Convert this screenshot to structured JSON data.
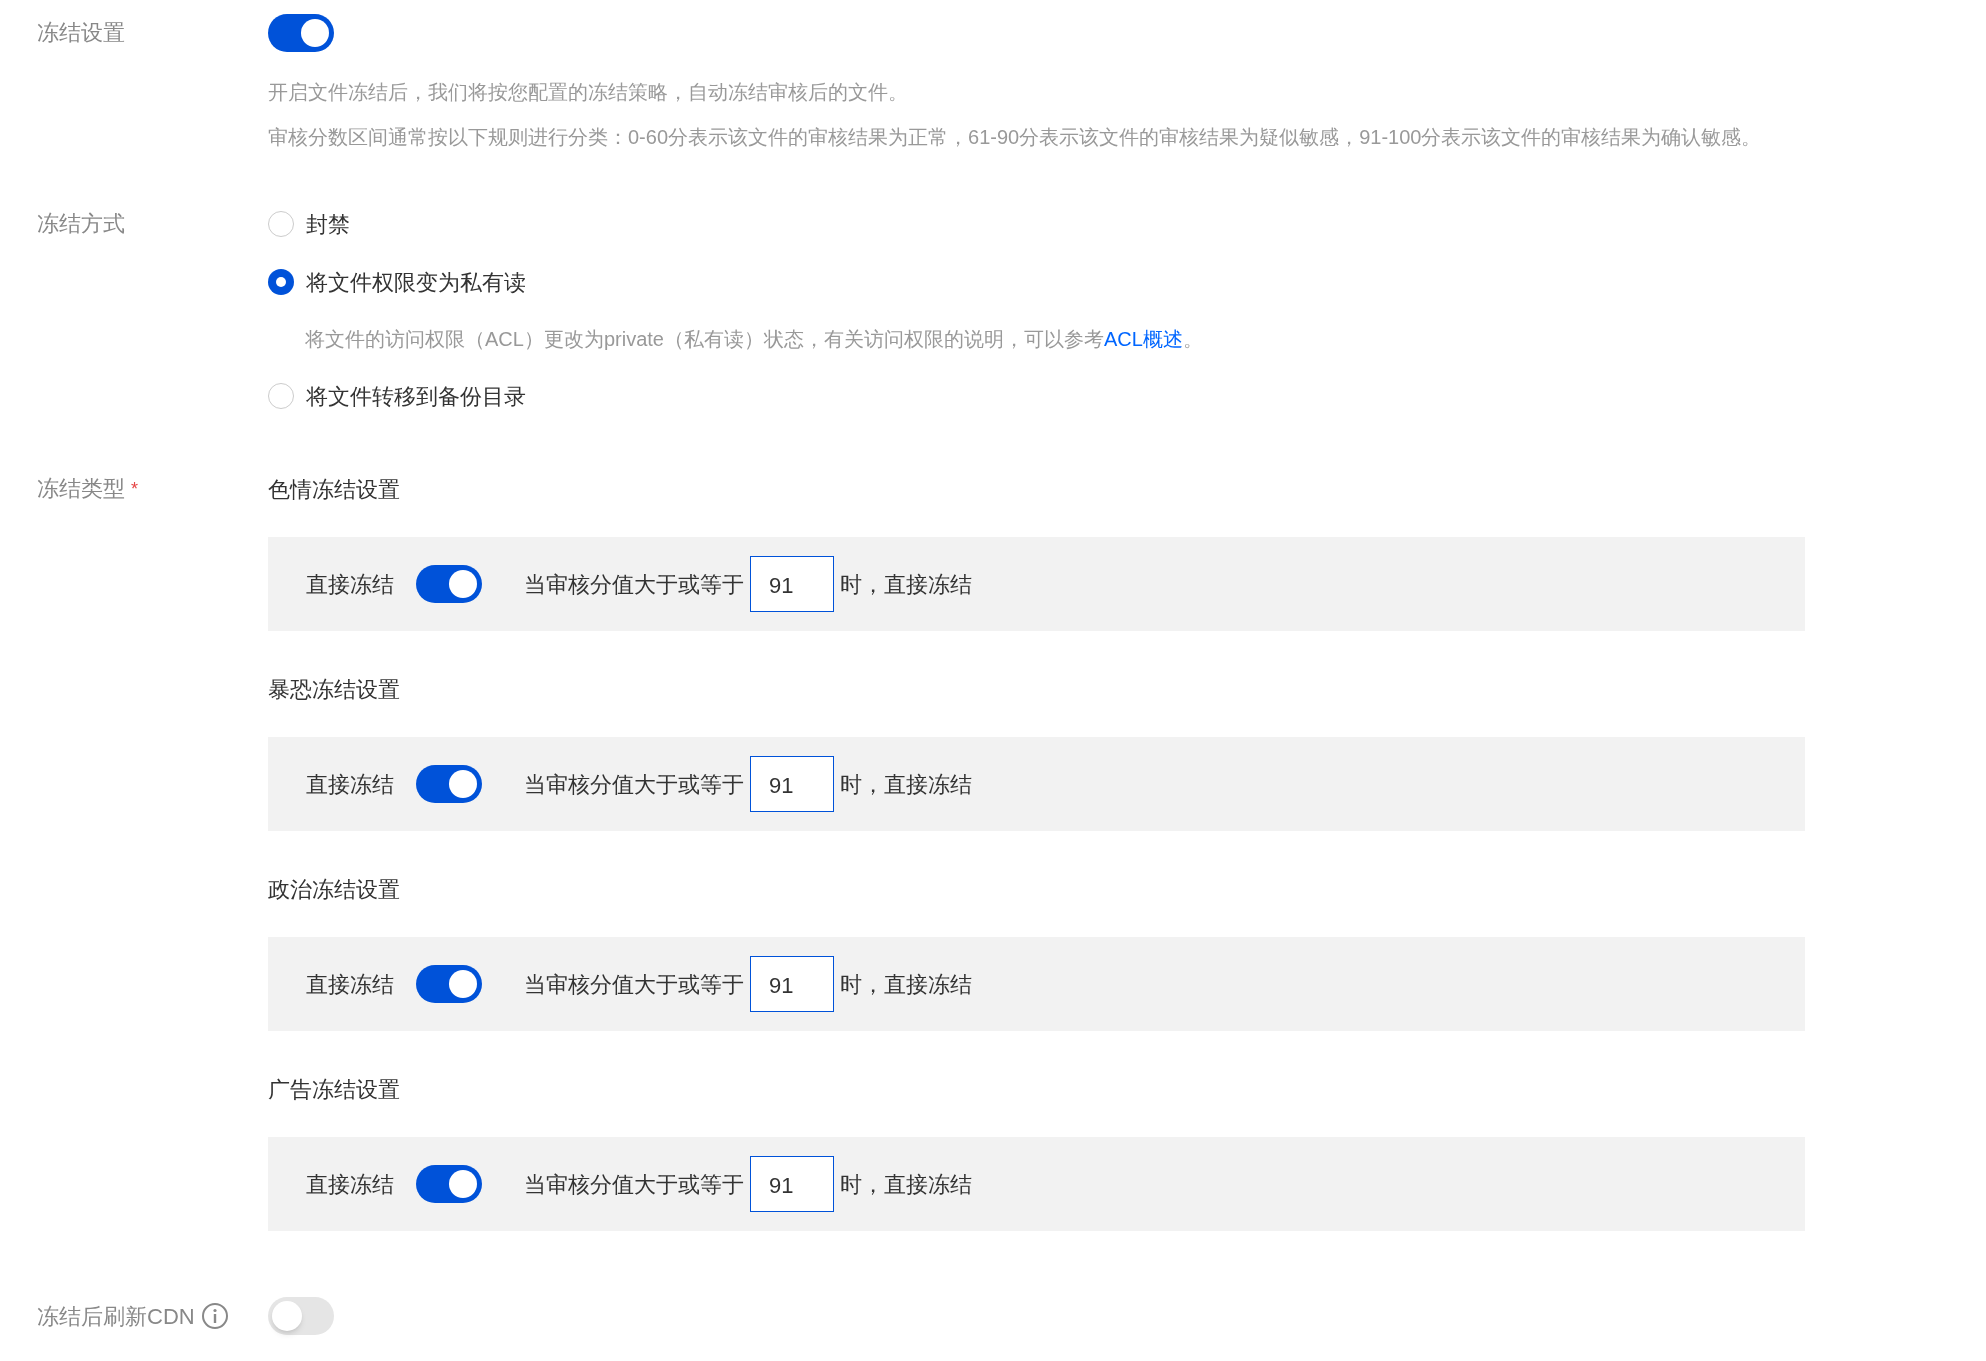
{
  "freeze_settings": {
    "label": "冻结设置",
    "on": true,
    "descriptions": [
      "开启文件冻结后，我们将按您配置的冻结策略，自动冻结审核后的文件。",
      "审核分数区间通常按以下规则进行分类：0-60分表示该文件的审核结果为正常，61-90分表示该文件的审核结果为疑似敏感，91-100分表示该文件的审核结果为确认敏感。"
    ]
  },
  "freeze_method": {
    "label": "冻结方式",
    "options": [
      {
        "label": "封禁",
        "selected": false
      },
      {
        "label": "将文件权限变为私有读",
        "selected": true,
        "note": {
          "text": "将文件的访问权限（ACL）更改为private（私有读）状态，有关访问权限的说明，可以参考",
          "link": "ACL概述",
          "after": "。"
        }
      },
      {
        "label": "将文件转移到备份目录",
        "selected": false
      }
    ]
  },
  "freeze_types": {
    "label": "冻结类型",
    "required_mark": "*",
    "sections": [
      {
        "title": "色情冻结设置",
        "toggle_label": "直接冻结",
        "on": true,
        "condition": "当审核分值大于或等于",
        "value": "91",
        "suffix": "时，直接冻结"
      },
      {
        "title": "暴恐冻结设置",
        "toggle_label": "直接冻结",
        "on": true,
        "condition": "当审核分值大于或等于",
        "value": "91",
        "suffix": "时，直接冻结"
      },
      {
        "title": "政治冻结设置",
        "toggle_label": "直接冻结",
        "on": true,
        "condition": "当审核分值大于或等于",
        "value": "91",
        "suffix": "时，直接冻结"
      },
      {
        "title": "广告冻结设置",
        "toggle_label": "直接冻结",
        "on": true,
        "condition": "当审核分值大于或等于",
        "value": "91",
        "suffix": "时，直接冻结"
      }
    ]
  },
  "cdn_refresh": {
    "label": "冻结后刷新CDN",
    "on": false
  }
}
